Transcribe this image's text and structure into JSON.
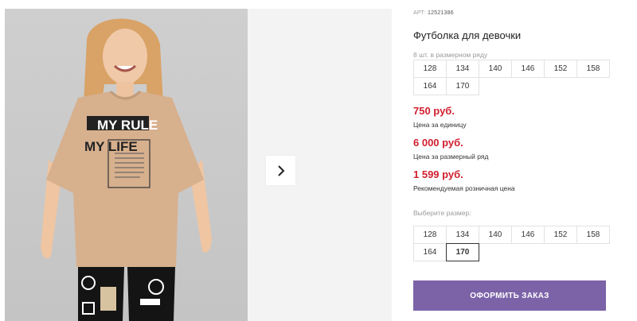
{
  "product": {
    "art_prefix": "АРТ:",
    "art_number": "12521386",
    "title": "Футболка для девочки",
    "pack_label": "8 шт. в размерном ряду",
    "pack_sizes": [
      "128",
      "134",
      "140",
      "146",
      "152",
      "158",
      "164",
      "170"
    ],
    "prices": [
      {
        "value": "750 руб.",
        "note": "Цена за единицу"
      },
      {
        "value": "6 000 руб.",
        "note": "Цена за размерный ряд"
      },
      {
        "value": "1 599 руб.",
        "note": "Рекомендуемая розничная цена"
      }
    ],
    "choose_label": "Выберите размер:",
    "choose_sizes": [
      "128",
      "134",
      "140",
      "146",
      "152",
      "158",
      "164",
      "170"
    ],
    "selected_size": "170",
    "order_button": "ОФОРМИТЬ ЗАКАЗ"
  },
  "photo": {
    "print_line1": "MY RULE",
    "print_line2": "MY LIFE"
  },
  "icons": {
    "next": "chevron-right-icon"
  },
  "colors": {
    "price": "#d01f2e",
    "button": "#7c63a8",
    "photo_bg": "#c9c9c9",
    "tshirt": "#d7b08e"
  }
}
